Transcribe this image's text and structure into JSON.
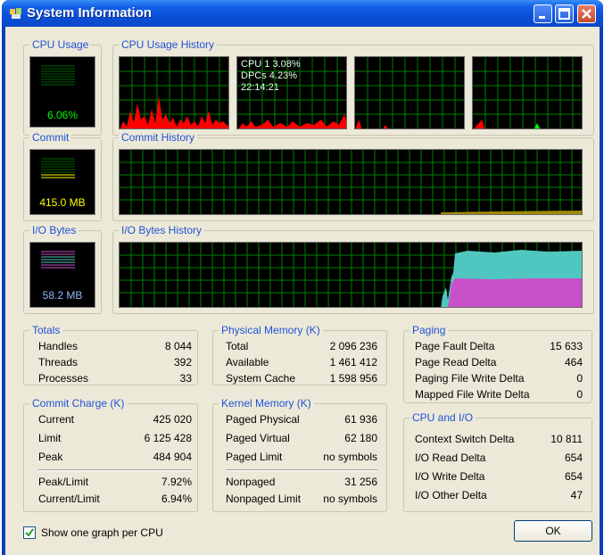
{
  "window": {
    "title": "System Information"
  },
  "panels": {
    "cpu_usage": {
      "title": "CPU Usage",
      "value": "6.06%"
    },
    "cpu_history": {
      "title": "CPU Usage History",
      "tooltip_line1": "CPU 1 3.08%",
      "tooltip_line2": "DPCs 4.23%",
      "tooltip_line3": "22:14:21"
    },
    "commit": {
      "title": "Commit",
      "value": "415.0 MB"
    },
    "commit_history": {
      "title": "Commit History"
    },
    "io_bytes": {
      "title": "I/O Bytes",
      "value": "58.2 MB"
    },
    "io_history": {
      "title": "I/O Bytes History"
    }
  },
  "totals": {
    "title": "Totals",
    "rows": [
      {
        "label": "Handles",
        "value": "8 044"
      },
      {
        "label": "Threads",
        "value": "392"
      },
      {
        "label": "Processes",
        "value": "33"
      }
    ]
  },
  "commit_charge": {
    "title": "Commit Charge (K)",
    "rows": [
      {
        "label": "Current",
        "value": "425 020"
      },
      {
        "label": "Limit",
        "value": "6 125 428"
      },
      {
        "label": "Peak",
        "value": "484 904"
      },
      {
        "label": "Peak/Limit",
        "value": "7.92%"
      },
      {
        "label": "Current/Limit",
        "value": "6.94%"
      }
    ]
  },
  "physical_memory": {
    "title": "Physical Memory (K)",
    "rows": [
      {
        "label": "Total",
        "value": "2 096 236"
      },
      {
        "label": "Available",
        "value": "1 461 412"
      },
      {
        "label": "System Cache",
        "value": "1 598 956"
      }
    ]
  },
  "kernel_memory": {
    "title": "Kernel Memory (K)",
    "rows": [
      {
        "label": "Paged Physical",
        "value": "61 936"
      },
      {
        "label": "Paged Virtual",
        "value": "62 180"
      },
      {
        "label": "Paged Limit",
        "value": "no symbols"
      },
      {
        "label": "Nonpaged",
        "value": "31 256"
      },
      {
        "label": "Nonpaged Limit",
        "value": "no symbols"
      }
    ]
  },
  "paging": {
    "title": "Paging",
    "rows": [
      {
        "label": "Page Fault Delta",
        "value": "15 633"
      },
      {
        "label": "Page Read Delta",
        "value": "464"
      },
      {
        "label": "Paging File Write Delta",
        "value": "0"
      },
      {
        "label": "Mapped File Write Delta",
        "value": "0"
      }
    ]
  },
  "cpu_io": {
    "title": "CPU and I/O",
    "rows": [
      {
        "label": "Context Switch Delta",
        "value": "10 811"
      },
      {
        "label": "I/O Read Delta",
        "value": "654"
      },
      {
        "label": "I/O Write Delta",
        "value": "654"
      },
      {
        "label": "I/O Other Delta",
        "value": "47"
      }
    ]
  },
  "footer": {
    "checkbox_label": "Show one graph per CPU",
    "checkbox_checked": true,
    "ok_label": "OK"
  },
  "colors": {
    "graph_bg": "#000000",
    "grid": "#008000",
    "cpu_kernel": "#ff0000",
    "cpu_user": "#00ff00",
    "commit": "#ffff00",
    "io_read": "#4fc7c0",
    "io_write": "#c850c8",
    "group_title": "#2052d8",
    "meter_green": "#00ff00",
    "meter_yellow": "#ffff00",
    "meter_io": "#8fb8ff"
  }
}
